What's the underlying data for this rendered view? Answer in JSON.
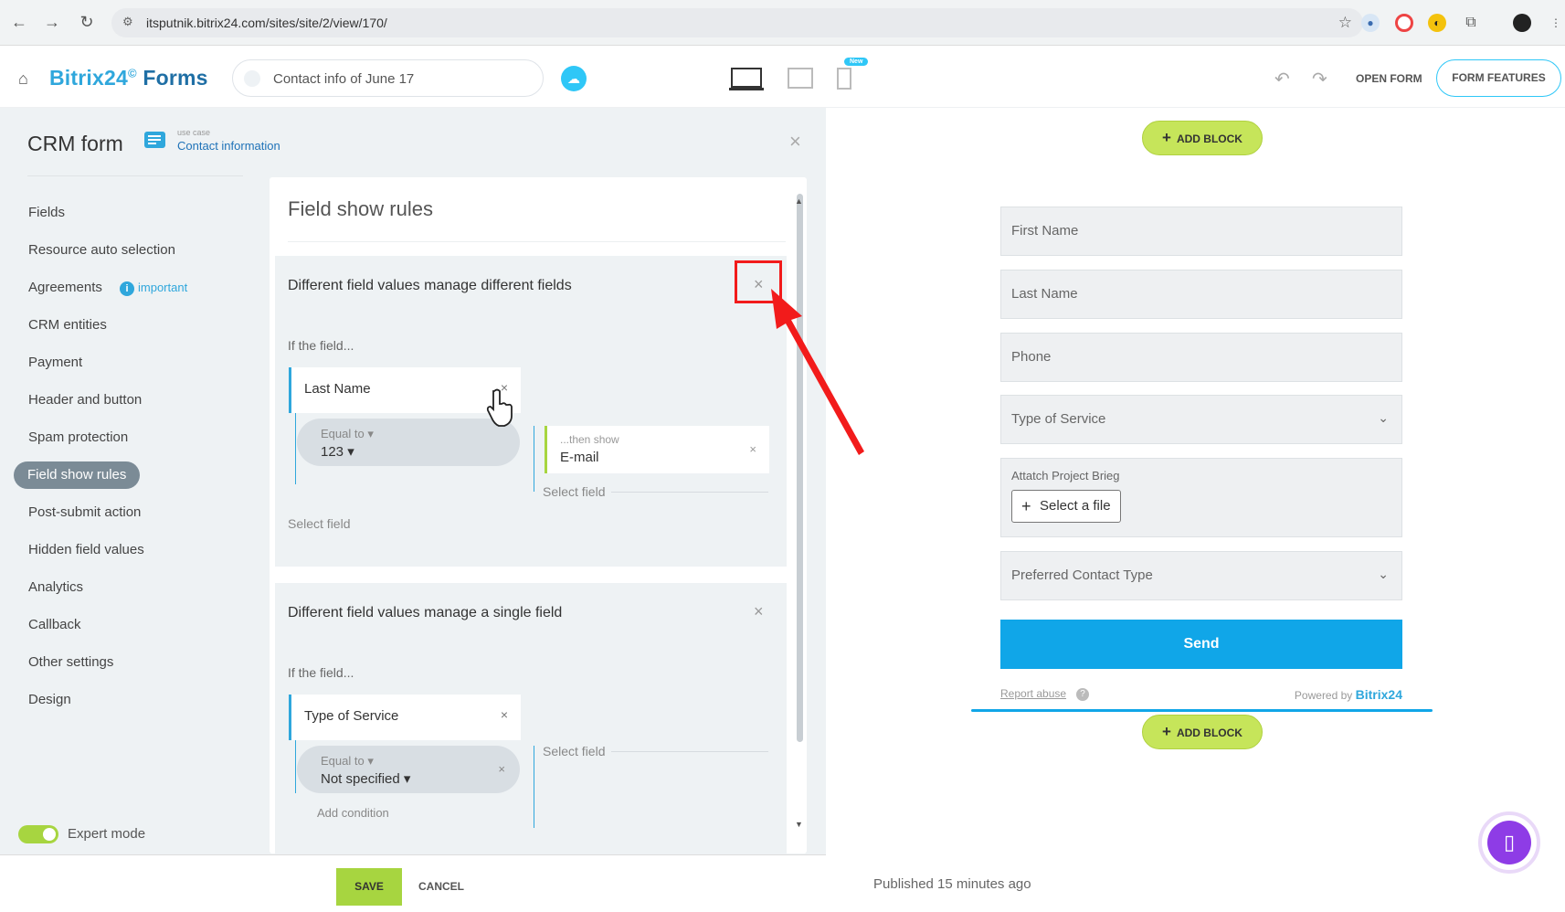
{
  "browser": {
    "url": "itsputnik.bitrix24.com/sites/site/2/view/170/"
  },
  "header": {
    "brand_main": "Bitrix24",
    "brand_sup": "©",
    "brand_product": "Forms",
    "form_title": "Contact info of June 17",
    "new_badge": "New",
    "open_form": "OPEN FORM",
    "form_features": "FORM FEATURES"
  },
  "settings": {
    "title": "CRM form",
    "use_case_label": "use case",
    "use_case_value": "Contact information",
    "menu": [
      {
        "label": "Fields"
      },
      {
        "label": "Resource auto selection"
      },
      {
        "label": "Agreements",
        "badge": "important"
      },
      {
        "label": "CRM entities"
      },
      {
        "label": "Payment"
      },
      {
        "label": "Header and button"
      },
      {
        "label": "Spam protection"
      },
      {
        "label": "Field show rules",
        "active": true
      },
      {
        "label": "Post-submit action"
      },
      {
        "label": "Hidden field values"
      },
      {
        "label": "Analytics"
      },
      {
        "label": "Callback"
      },
      {
        "label": "Other settings"
      },
      {
        "label": "Design"
      }
    ],
    "expert_mode": "Expert mode",
    "expert_mode_on": true,
    "save": "SAVE",
    "cancel": "CANCEL"
  },
  "rules": {
    "title": "Field show rules",
    "cards": [
      {
        "heading": "Different field values manage different fields",
        "if_label": "If the field...",
        "field": "Last Name",
        "condition_op": "Equal to ▾",
        "condition_value": "123 ▾",
        "then_label": "...then show",
        "then_value": "E-mail",
        "select_field_1": "Select field",
        "select_field_2": "Select field"
      },
      {
        "heading": "Different field values manage a single field",
        "if_label": "If the field...",
        "field": "Type of Service",
        "condition_op": "Equal to ▾",
        "condition_value": "Not specified ▾",
        "select_field_1": "Select field",
        "add_condition": "Add condition"
      }
    ]
  },
  "preview": {
    "add_block": "ADD BLOCK",
    "fields": [
      {
        "label": "First Name"
      },
      {
        "label": "Last Name"
      },
      {
        "label": "Phone"
      },
      {
        "label": "Type of Service",
        "dropdown": true
      }
    ],
    "attach_label": "Attatch Project Brieg",
    "select_file": "Select a file",
    "contact_type": "Preferred Contact Type",
    "send": "Send",
    "report_abuse": "Report abuse",
    "powered_by": "Powered by",
    "powered_brand": "Bitrix24",
    "published": "Published 15 minutes ago"
  },
  "colors": {
    "accent": "#2fa7dc",
    "send": "#10a6e8",
    "green": "#a7d540",
    "annotation": "#f21b1b"
  },
  "icons": [
    "back-icon",
    "forward-icon",
    "reload-icon",
    "site-info-icon",
    "star-icon",
    "home-icon",
    "cloud-icon",
    "desktop-icon",
    "tablet-icon",
    "mobile-icon",
    "undo-icon",
    "redo-icon",
    "close-icon",
    "info-icon",
    "chevron-down-icon",
    "plus-icon",
    "help-icon",
    "phone-icon",
    "pointer-hand-icon",
    "red-arrow"
  ]
}
